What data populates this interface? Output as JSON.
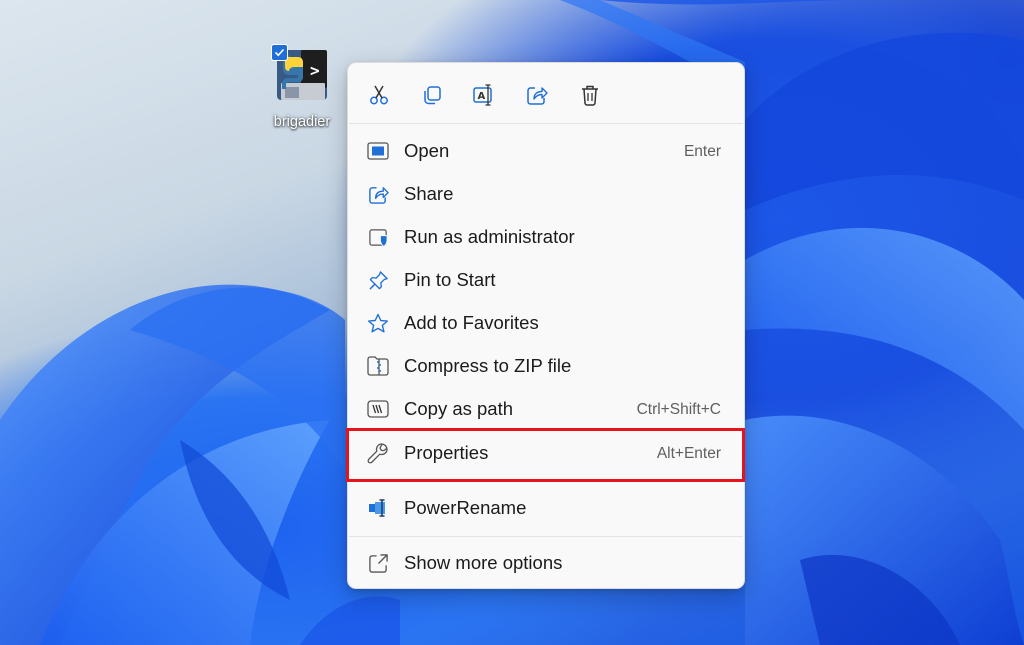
{
  "desktop": {
    "icon_label": "brigadier"
  },
  "context_menu": {
    "toolbar": [
      {
        "icon": "cut-icon"
      },
      {
        "icon": "copy-icon"
      },
      {
        "icon": "rename-icon"
      },
      {
        "icon": "share-icon"
      },
      {
        "icon": "delete-icon"
      }
    ],
    "items": [
      {
        "label": "Open",
        "shortcut": "Enter",
        "icon": "open-icon"
      },
      {
        "label": "Share",
        "shortcut": "",
        "icon": "share-icon"
      },
      {
        "label": "Run as administrator",
        "shortcut": "",
        "icon": "shield-icon"
      },
      {
        "label": "Pin to Start",
        "shortcut": "",
        "icon": "pin-icon"
      },
      {
        "label": "Add to Favorites",
        "shortcut": "",
        "icon": "star-icon"
      },
      {
        "label": "Compress to ZIP file",
        "shortcut": "",
        "icon": "zip-folder-icon"
      },
      {
        "label": "Copy as path",
        "shortcut": "Ctrl+Shift+C",
        "icon": "copy-path-icon"
      },
      {
        "label": "Properties",
        "shortcut": "Alt+Enter",
        "icon": "wrench-icon"
      },
      {
        "label": "PowerRename",
        "shortcut": "",
        "icon": "power-rename-icon"
      },
      {
        "label": "Show more options",
        "shortcut": "",
        "icon": "show-more-icon"
      }
    ]
  },
  "colors": {
    "accent": "#1f6fd6",
    "highlight_border": "#e6131a",
    "menu_background": "#f9f9f9"
  }
}
